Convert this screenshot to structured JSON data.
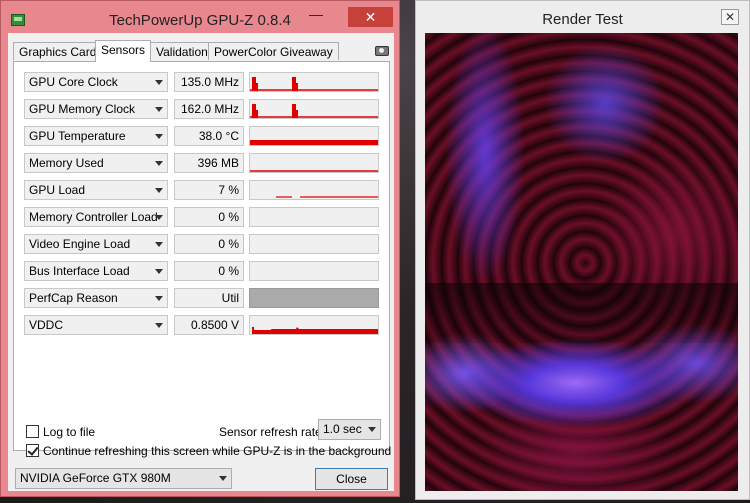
{
  "gpuz": {
    "title": "TechPowerUp GPU-Z 0.8.4",
    "minimize_glyph": "—",
    "close_glyph": "✕",
    "tabs": [
      {
        "label": "Graphics Card"
      },
      {
        "label": "Sensors"
      },
      {
        "label": "Validation"
      },
      {
        "label": "PowerColor Giveaway"
      }
    ],
    "active_tab": "Sensors",
    "sensors": [
      {
        "name": "GPU Core Clock",
        "value": "135.0 MHz",
        "graph": "spiky"
      },
      {
        "name": "GPU Memory Clock",
        "value": "162.0 MHz",
        "graph": "spiky"
      },
      {
        "name": "GPU Temperature",
        "value": "38.0 °C",
        "graph": "flat-high"
      },
      {
        "name": "Memory Used",
        "value": "396 MB",
        "graph": "flat-low"
      },
      {
        "name": "GPU Load",
        "value": "7 %",
        "graph": "dashes"
      },
      {
        "name": "Memory Controller Load",
        "value": "0 %",
        "graph": "empty"
      },
      {
        "name": "Video Engine Load",
        "value": "0 %",
        "graph": "empty"
      },
      {
        "name": "Bus Interface Load",
        "value": "0 %",
        "graph": "empty"
      },
      {
        "name": "PerfCap Reason",
        "value": "Util",
        "graph": "gray"
      },
      {
        "name": "VDDC",
        "value": "0.8500 V",
        "graph": "vddc"
      }
    ],
    "log_to_file_label": "Log to file",
    "log_to_file_checked": false,
    "continue_refresh_label": "Continue refreshing this screen while GPU-Z is in the background",
    "continue_refresh_checked": true,
    "refresh_rate_label": "Sensor refresh rate:",
    "refresh_rate_value": "1.0 sec",
    "gpu_selected": "NVIDIA GeForce GTX 980M",
    "close_button_label": "Close",
    "graph_color": "#e00000"
  },
  "render_test": {
    "title": "Render Test",
    "close_glyph": "✕"
  }
}
